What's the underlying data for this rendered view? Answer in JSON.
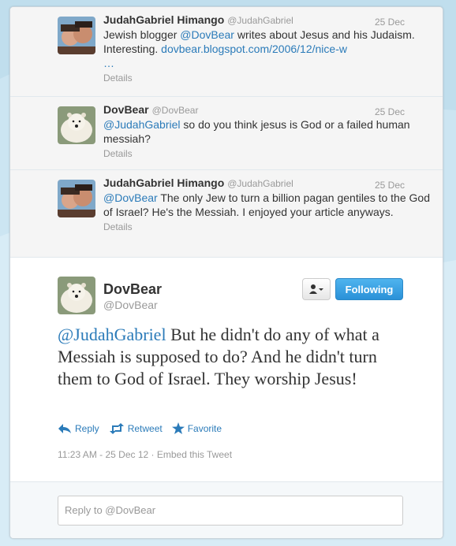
{
  "colors": {
    "link": "#2b7bb9",
    "follow_button": "#2a91d8",
    "background": "#c0deed"
  },
  "conversation": [
    {
      "name": "JudahGabriel Himango",
      "handle": "@JudahGabriel",
      "date": "25 Dec",
      "text_before": "Jewish blogger ",
      "mention": "@DovBear",
      "text_after": " writes about Jesus and his Judaism. Interesting. ",
      "link": "dovbear.blogspot.com/2006/12/nice-w",
      "ellipsis": "…",
      "details": "Details",
      "avatar_icon": "couple-photo"
    },
    {
      "name": "DovBear",
      "handle": "@DovBear",
      "date": "25 Dec",
      "mention": "@JudahGabriel",
      "text_after": " so do you think jesus is God or a failed human messiah?",
      "details": "Details",
      "avatar_icon": "polar-bear-photo"
    },
    {
      "name": "JudahGabriel Himango",
      "handle": "@JudahGabriel",
      "date": "25 Dec",
      "mention": "@DovBear",
      "text_after": " The only Jew to turn a billion pagan gentiles to the God of Israel? He's the Messiah. I enjoyed your article anyways.",
      "details": "Details",
      "avatar_icon": "couple-photo"
    }
  ],
  "main_tweet": {
    "name": "DovBear",
    "handle": "@DovBear",
    "mention": "@JudahGabriel",
    "text": " But he didn't do any of what a Messiah is supposed to do? And he didn't turn them to God of Israel. They worship Jesus!",
    "user_menu_icon": "user-dropdown-icon",
    "follow_label": "Following",
    "actions": {
      "reply": "Reply",
      "retweet": "Retweet",
      "favorite": "Favorite"
    },
    "timestamp": "11:23 AM - 25 Dec 12",
    "separator": " · ",
    "embed": "Embed this Tweet"
  },
  "reply_box": {
    "placeholder": "Reply to @DovBear"
  }
}
